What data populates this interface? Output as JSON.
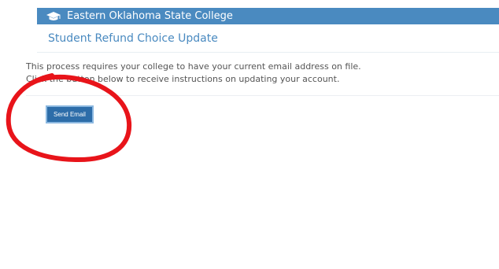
{
  "header": {
    "icon": "graduation-cap-icon",
    "college_name": "Eastern Oklahoma State College",
    "background_color": "#4a8ac0"
  },
  "page": {
    "title": "Student Refund Choice Update"
  },
  "message": {
    "line1": "This process requires your college to have your current email address on file.",
    "line2": "Click the button below to receive instructions on updating your account."
  },
  "actions": {
    "send_email_label": "Send Email"
  },
  "annotation": {
    "shape": "hand-drawn-circle",
    "color": "#e8141a"
  }
}
